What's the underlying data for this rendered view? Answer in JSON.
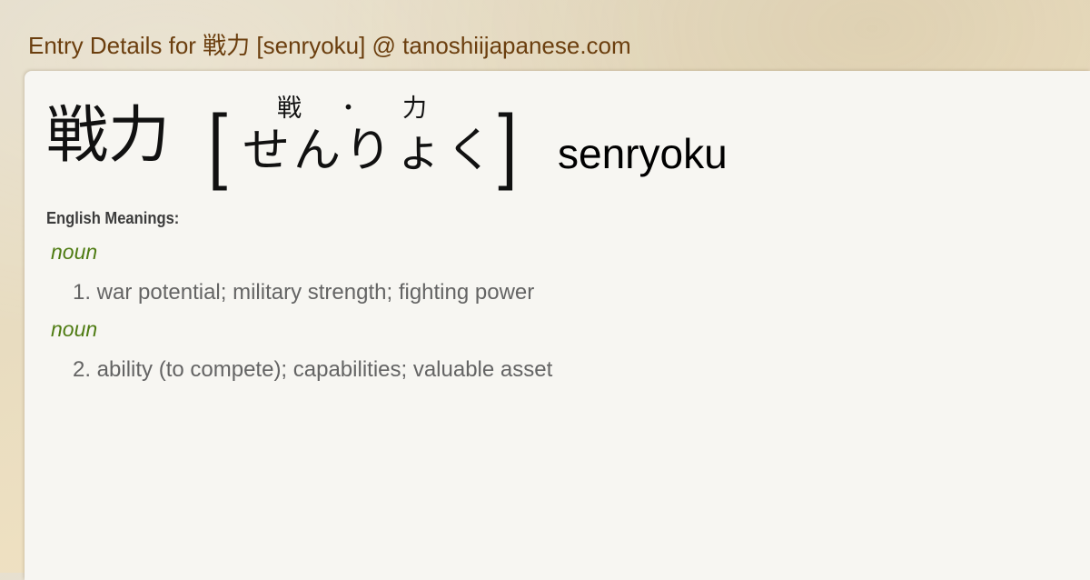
{
  "page": {
    "title": "Entry Details for 戦力 [senryoku] @ tanoshiijapanese.com"
  },
  "entry": {
    "headword": "戦力",
    "bracket_open": "[",
    "bracket_close": "]",
    "reading_kana": "せんりょく",
    "furigana": [
      "戦",
      "・",
      "力"
    ],
    "romaji": "senryoku"
  },
  "meanings": {
    "label": "English Meanings:",
    "senses": [
      {
        "pos": "noun",
        "text": "1. war potential; military strength; fighting power"
      },
      {
        "pos": "noun",
        "text": "2. ability (to compete); capabilities; valuable asset"
      }
    ]
  },
  "colors": {
    "title": "#6b3e0e",
    "pos": "#4f7c13",
    "sense_text": "#646464",
    "card_bg": "#f7f6f2"
  }
}
